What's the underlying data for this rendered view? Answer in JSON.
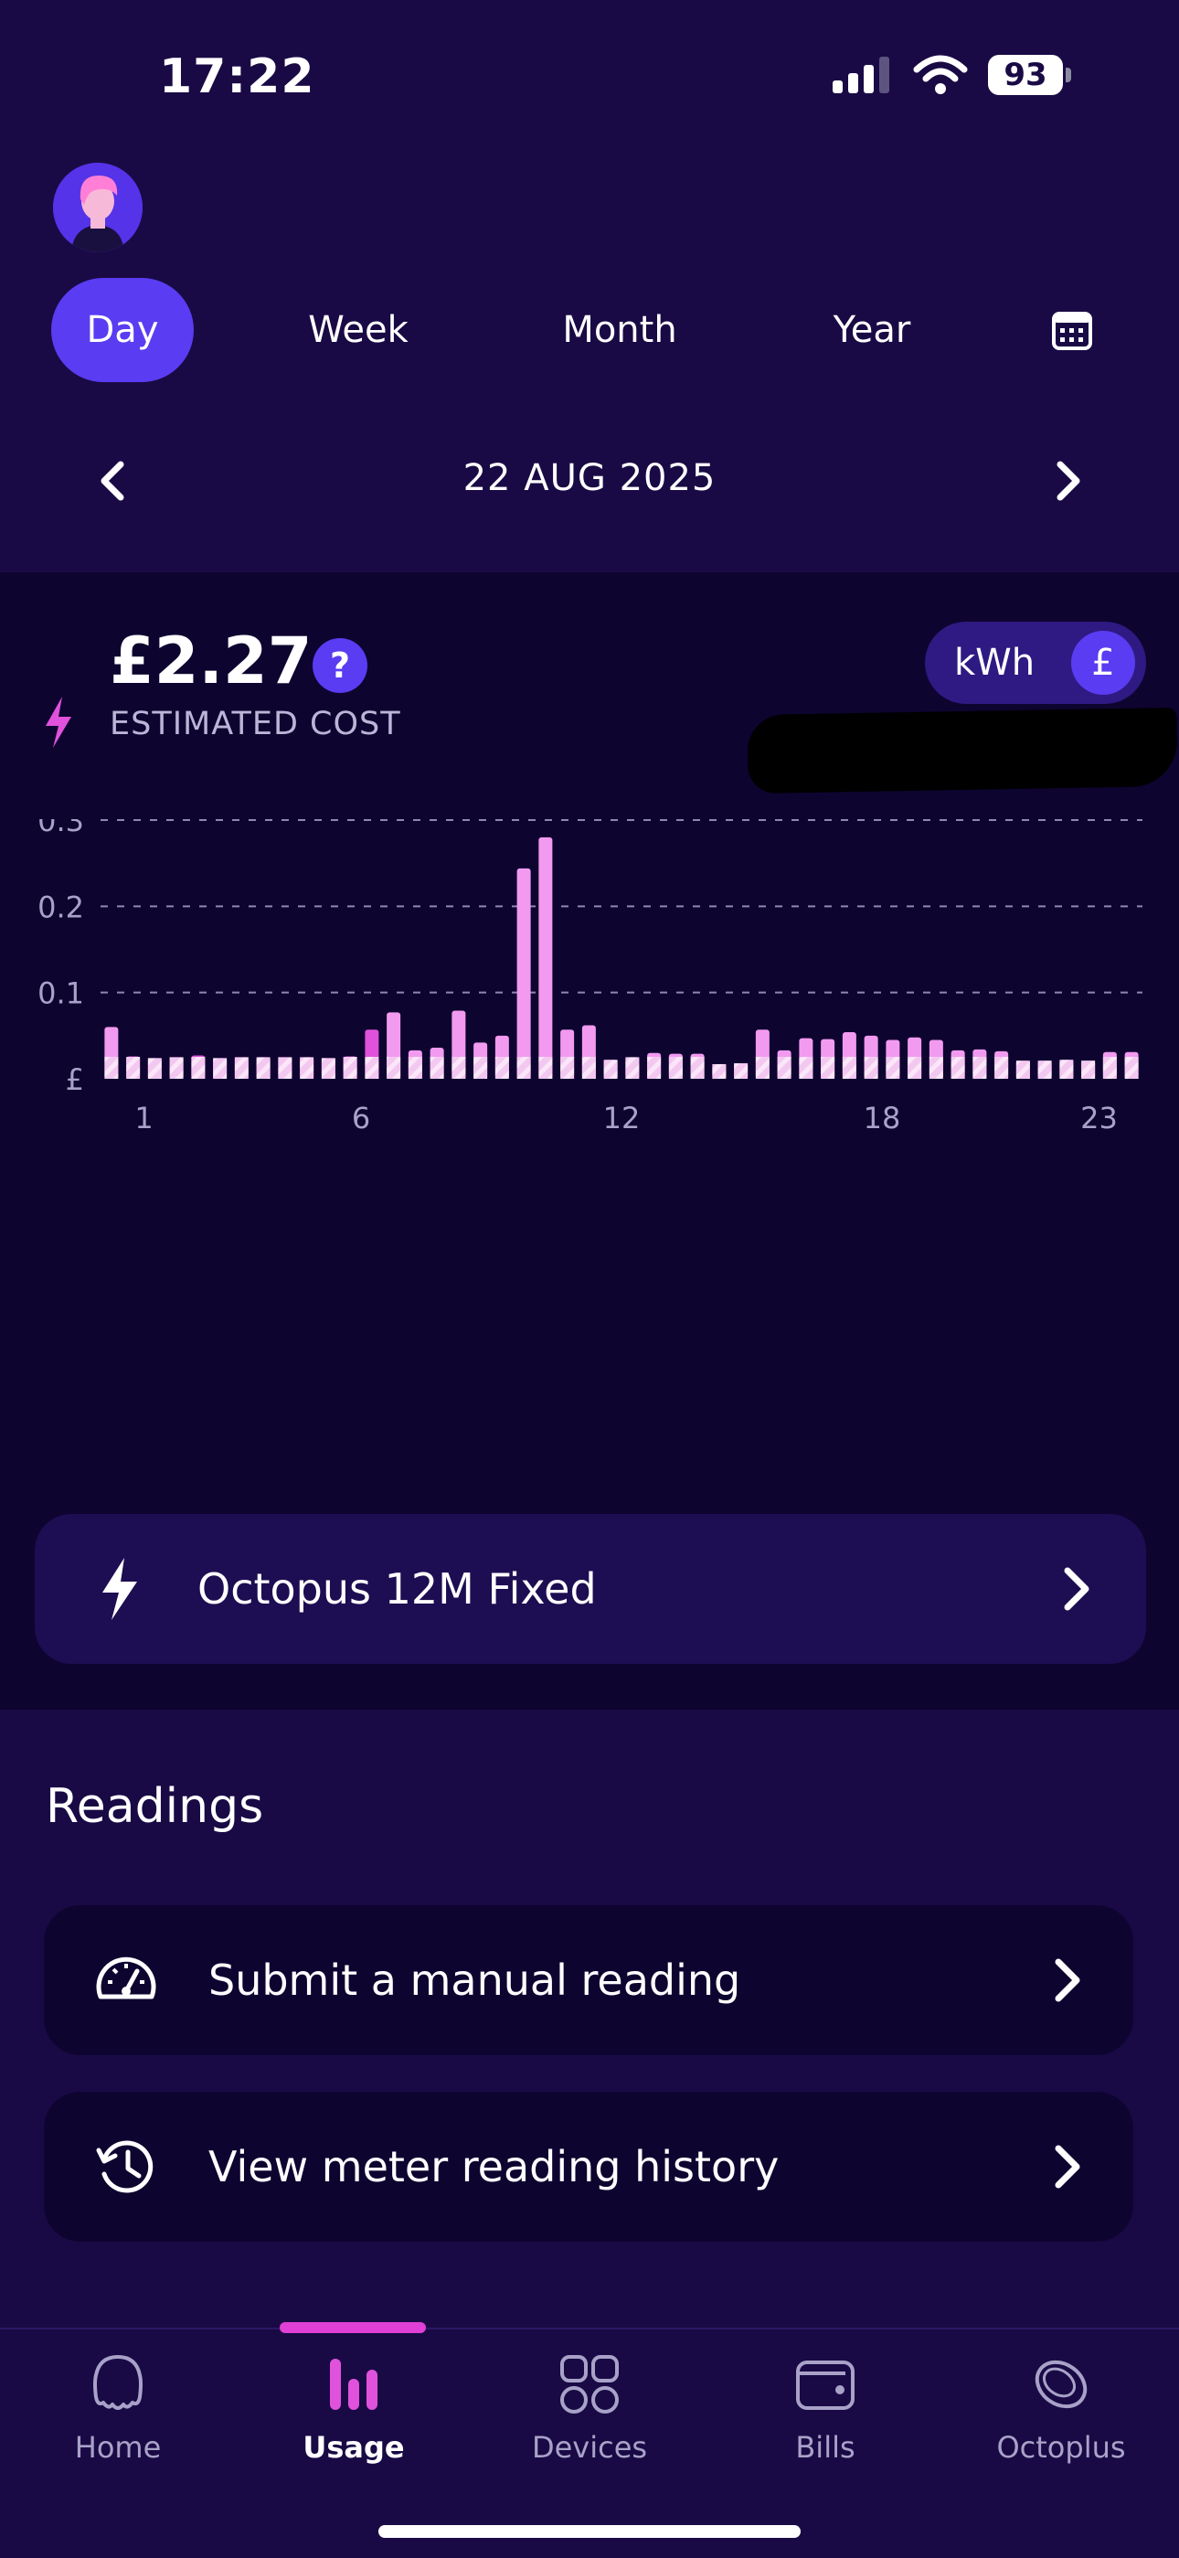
{
  "status": {
    "time": "17:22",
    "battery": "93"
  },
  "tabs": [
    "Day",
    "Week",
    "Month",
    "Year"
  ],
  "active_tab": "Day",
  "date": "22 AUG 2025",
  "cost": {
    "value": "£2.27",
    "help": "?",
    "label": "ESTIMATED COST"
  },
  "unit_toggle": {
    "kwh": "kWh",
    "gbp": "£",
    "selected": "£"
  },
  "colors": {
    "accent": "#5a3cf2",
    "bar": "#f29af0",
    "bar_highlight": "#e052dc",
    "panel": "#0e0430",
    "background": "#190a45"
  },
  "chart_data": {
    "type": "bar",
    "y_ticks": [
      "0.3",
      "0.2",
      "0.1",
      "£"
    ],
    "ylim": [
      0,
      0.3
    ],
    "grid": true,
    "x_ticks": [
      "1",
      "6",
      "12",
      "18",
      "23"
    ],
    "x_tick_index": [
      2,
      12,
      24,
      36,
      46
    ],
    "values": [
      0.06,
      0.026,
      0.024,
      0.025,
      0.027,
      0.024,
      0.025,
      0.025,
      0.025,
      0.025,
      0.024,
      0.026,
      0.057,
      0.077,
      0.033,
      0.036,
      0.079,
      0.042,
      0.05,
      0.244,
      0.28,
      0.057,
      0.062,
      0.022,
      0.025,
      0.03,
      0.029,
      0.029,
      0.017,
      0.018,
      0.057,
      0.033,
      0.047,
      0.046,
      0.054,
      0.05,
      0.045,
      0.048,
      0.045,
      0.033,
      0.034,
      0.032,
      0.021,
      0.021,
      0.022,
      0.021,
      0.031,
      0.031
    ],
    "highlight_bars": [
      1,
      2,
      3,
      4,
      5,
      6,
      7,
      8,
      9,
      10,
      11,
      12
    ]
  },
  "tariff": {
    "label": "Octopus 12M Fixed"
  },
  "readings": {
    "title": "Readings",
    "items": [
      {
        "label": "Submit a manual reading",
        "icon": "gauge-icon"
      },
      {
        "label": "View meter reading history",
        "icon": "history-icon"
      }
    ]
  },
  "bottom_nav": [
    {
      "label": "Home",
      "icon": "octopus-icon"
    },
    {
      "label": "Usage",
      "icon": "bar-chart-icon"
    },
    {
      "label": "Devices",
      "icon": "grid-icon"
    },
    {
      "label": "Bills",
      "icon": "wallet-icon"
    },
    {
      "label": "Octoplus",
      "icon": "coin-icon"
    }
  ],
  "active_nav": "Usage"
}
